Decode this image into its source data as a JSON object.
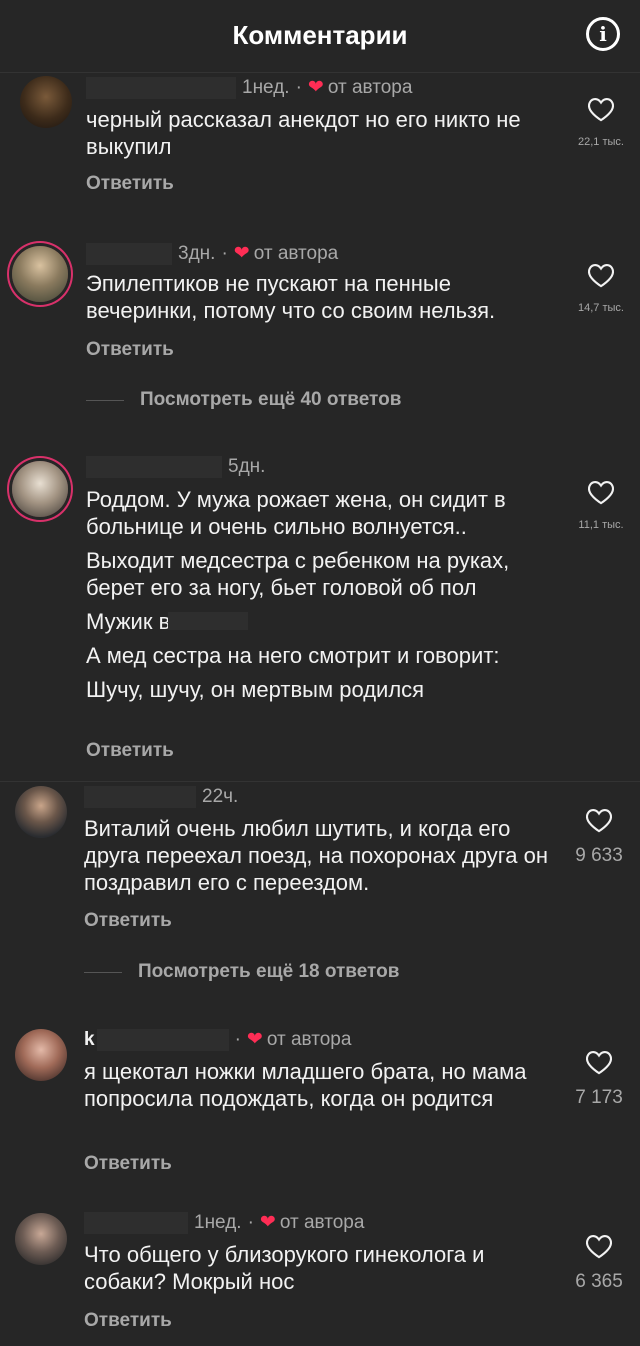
{
  "header": {
    "title": "Комментарии",
    "info_icon": "info-icon"
  },
  "comments": [
    {
      "time": "1нед.",
      "author_badge": "от автора",
      "lines": [
        "черный рассказал анекдот но его никто не выкупил"
      ],
      "reply": "Ответить",
      "likes": "22,1 тыс."
    },
    {
      "time": "3дн.",
      "author_badge": "от автора",
      "lines": [
        "Эпилептиков не пускают на пенные вечеринки, потому что со своим нельзя."
      ],
      "reply": "Ответить",
      "likes": "14,7 тыс.",
      "more": "Посмотреть ещё 40 ответов"
    },
    {
      "time": "5дн.",
      "lines": [
        "Роддом. У мужа рожает жена, он сидит в больнице и очень сильно волнуется..",
        "Выходит медсестра с ребенком на руках, берет его за ногу, бьет головой об пол",
        "Мужик в",
        "А мед сестра на него смотрит и говорит:",
        "Шучу, шучу, он мертвым родился"
      ],
      "reply": "Ответить",
      "likes": "11,1 тыс."
    },
    {
      "time": "22ч.",
      "lines": [
        "Виталий очень любил шутить, и когда его друга переехал поезд, на похоронах друга он поздравил его с переездом."
      ],
      "reply": "Ответить",
      "likes": "9 633",
      "more": "Посмотреть ещё 18 ответов"
    },
    {
      "time": "",
      "username_partial": "k",
      "author_badge": "от автора",
      "lines": [
        "я щекотал ножки младшего брата, но мама попросила подождать, когда он родится"
      ],
      "reply": "Ответить",
      "likes": "7 173"
    },
    {
      "time": "1нед.",
      "author_badge": "от автора",
      "lines": [
        "Что общего у близорукого гинеколога и собаки? Мокрый нос"
      ],
      "reply": "Ответить",
      "likes": "6 365"
    }
  ],
  "colors": {
    "background": "#262626",
    "heart": "#ff2d55",
    "muted": "#a8a8a8",
    "story_ring": "#d8316a"
  }
}
